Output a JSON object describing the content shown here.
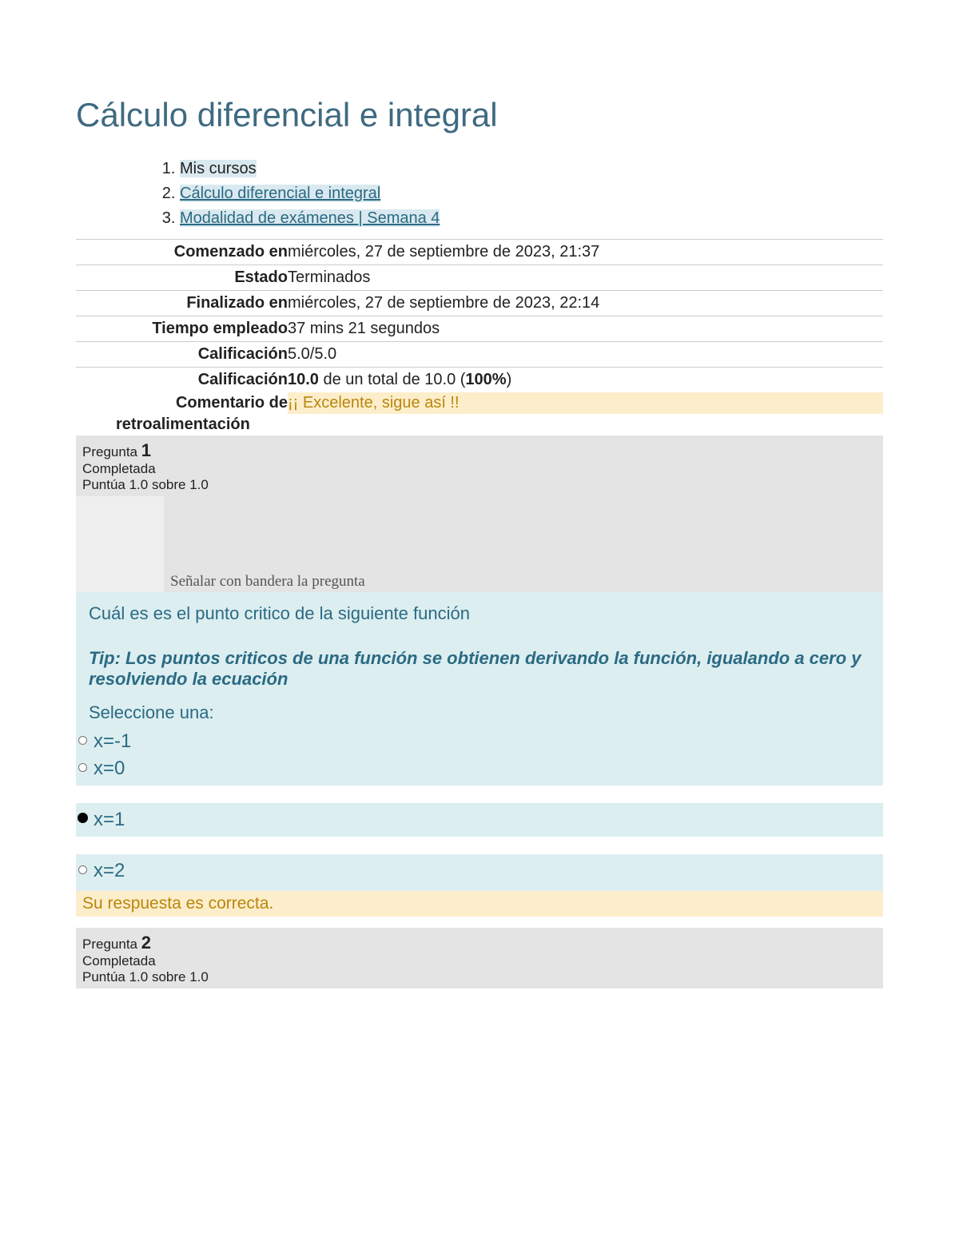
{
  "title": "Cálculo diferencial e integral",
  "breadcrumb": {
    "items": [
      {
        "label": "Mis cursos",
        "link": false
      },
      {
        "label": "Cálculo diferencial e integral",
        "link": true
      },
      {
        "label": "Modalidad de exámenes | Semana 4",
        "link": true
      }
    ]
  },
  "summary": {
    "rows": [
      {
        "label": "Comenzado en",
        "value": "miércoles, 27 de septiembre de 2023, 21:37"
      },
      {
        "label": "Estado",
        "value": "Terminados"
      },
      {
        "label": "Finalizado en",
        "value": "miércoles, 27 de septiembre de 2023, 22:14"
      },
      {
        "label": "Tiempo empleado",
        "value": "37 mins 21 segundos"
      },
      {
        "label": "Calificación",
        "value": "5.0/5.0"
      }
    ],
    "grade": {
      "label": "Calificación",
      "value_prefix": "10.0",
      "value_mid": " de un total de 10.0 (",
      "value_pct": "100%",
      "value_suffix": ")"
    },
    "feedback": {
      "label1": "Comentario de",
      "label2": "retroalimentación",
      "value": "¡¡ Excelente, sigue así !!"
    }
  },
  "q1": {
    "prefix": "Pregunta ",
    "number": "1",
    "state": "Completada",
    "score": "Puntúa 1.0 sobre 1.0",
    "flag": "Señalar con bandera la pregunta",
    "text": "Cuál es es el punto critico de la siguiente función",
    "tip": "Tip: Los puntos criticos de una función se obtienen derivando la función,  igualando a cero y resolviendo la ecuación",
    "select": "Seleccione una:",
    "options": [
      {
        "label": "x=-1",
        "selected": false
      },
      {
        "label": "x=0",
        "selected": false
      },
      {
        "label": "x=1",
        "selected": true
      },
      {
        "label": "x=2",
        "selected": false
      }
    ],
    "feedback": "Su respuesta es correcta."
  },
  "q2": {
    "prefix": "Pregunta ",
    "number": "2",
    "state": "Completada",
    "score": "Puntúa 1.0 sobre 1.0"
  }
}
